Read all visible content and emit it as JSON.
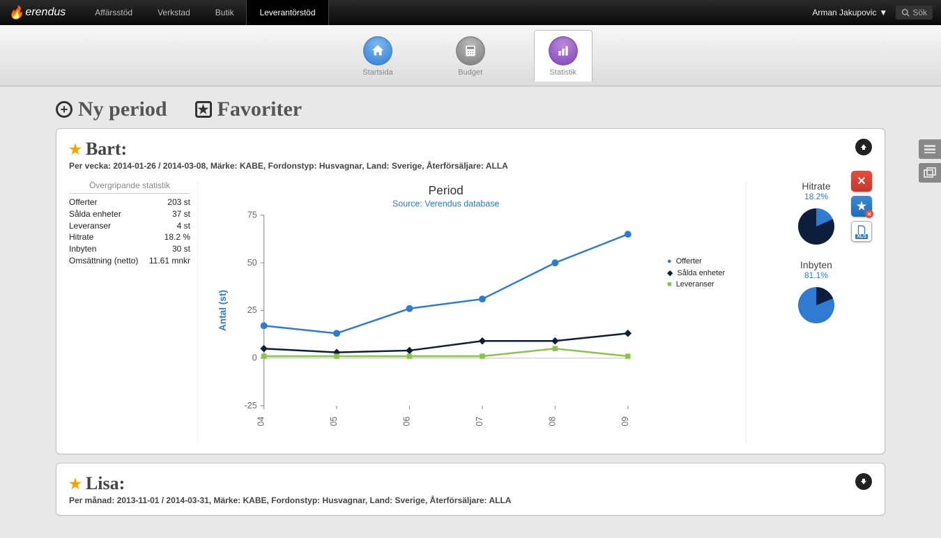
{
  "app": {
    "name": "erendus"
  },
  "topnav": {
    "items": [
      "Affärsstöd",
      "Verkstad",
      "Butik",
      "Leverantörstöd"
    ],
    "activeIndex": 3
  },
  "user": {
    "name": "Arman Jakupovic"
  },
  "search": {
    "placeholder": "Sök"
  },
  "subnav": {
    "items": [
      {
        "label": "Startsida"
      },
      {
        "label": "Budget"
      },
      {
        "label": "Statistik"
      }
    ],
    "activeIndex": 2
  },
  "actions": {
    "newPeriod": "Ny period",
    "favorites": "Favoriter"
  },
  "cards": [
    {
      "name": "Bart:",
      "subtitle": "Per vecka: 2014-01-26 / 2014-03-08, Märke: KABE, Fordonstyp: Husvagnar, Land: Sverige, Återförsäljare: ALLA",
      "expanded": true,
      "stats": {
        "title": "Övergripande statistik",
        "rows": [
          {
            "label": "Offerter",
            "value": "203 st"
          },
          {
            "label": "Sålda enheter",
            "value": "37 st"
          },
          {
            "label": "Leveranser",
            "value": "4 st"
          },
          {
            "label": "Hitrate",
            "value": "18.2 %"
          },
          {
            "label": "Inbyten",
            "value": "30 st"
          },
          {
            "label": "Omsättning (netto)",
            "value": "11.61 mnkr"
          }
        ]
      },
      "gauges": [
        {
          "title": "Hitrate",
          "value": "18.2%",
          "fraction": 0.182
        },
        {
          "title": "Inbyten",
          "value": "81.1%",
          "fraction": 0.811
        }
      ]
    },
    {
      "name": "Lisa:",
      "subtitle": "Per månad: 2013-11-01 / 2014-03-31, Märke: KABE, Fordonstyp: Husvagnar, Land: Sverige, Återförsäljare: ALLA",
      "expanded": false
    }
  ],
  "chart_data": {
    "type": "line",
    "title": "Period",
    "subtitle": "Source: Verendus database",
    "ylabel": "Antal (st)",
    "ylim": [
      -25,
      75
    ],
    "yticks": [
      -25,
      0,
      25,
      50,
      75
    ],
    "categories": [
      "04",
      "05",
      "06",
      "07",
      "08",
      "09"
    ],
    "legend_position": "right",
    "series": [
      {
        "name": "Offerter",
        "color": "#2e7bd1",
        "values": [
          17,
          13,
          26,
          31,
          50,
          65
        ]
      },
      {
        "name": "Sålda enheter",
        "color": "#0c1e3a",
        "values": [
          5,
          3,
          4,
          9,
          9,
          13
        ]
      },
      {
        "name": "Leveranser",
        "color": "#8bc34a",
        "values": [
          1,
          1,
          1,
          1,
          5,
          1
        ]
      }
    ]
  }
}
